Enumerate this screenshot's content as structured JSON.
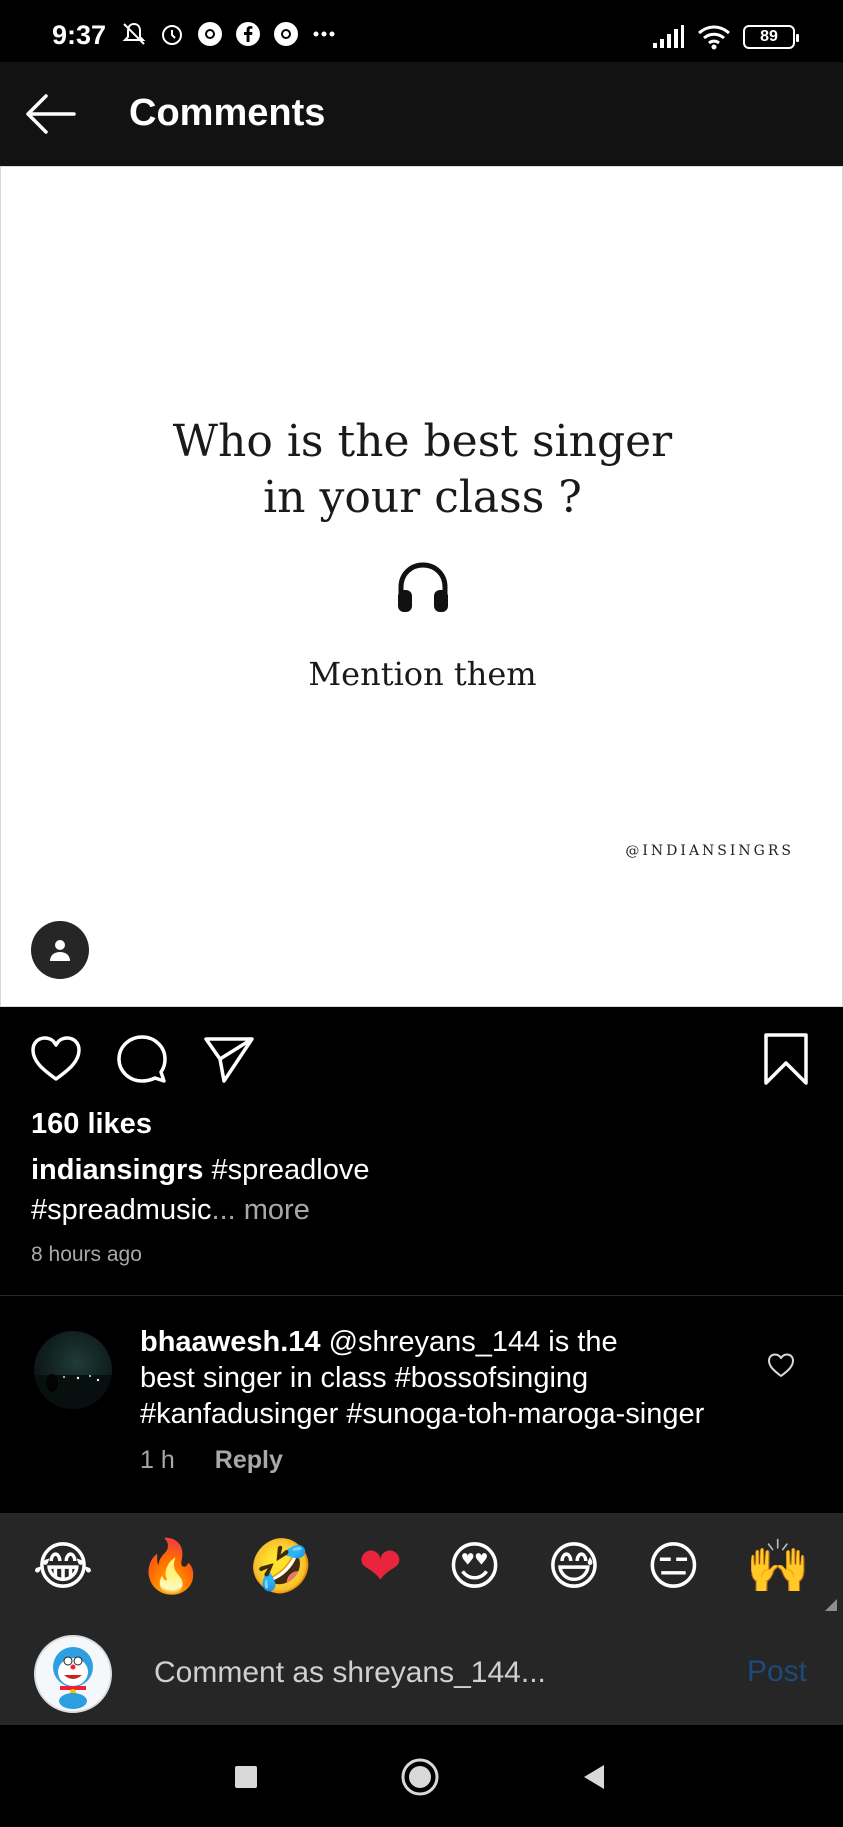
{
  "status_bar": {
    "time": "9:37",
    "battery": "89",
    "left_icons": [
      "mute-bell-icon",
      "alarm-icon",
      "chrome-icon",
      "facebook-icon",
      "chrome-icon",
      "more-dots-icon"
    ],
    "right_icons": [
      "signal-icon",
      "wifi-icon",
      "battery-icon"
    ]
  },
  "app_bar": {
    "title": "Comments",
    "back_icon": "arrow-left-icon"
  },
  "post": {
    "headline_line1": "Who is the best singer",
    "headline_line2": "in your class ?",
    "subtext": "Mention them",
    "watermark": "@INDIANSINGRS",
    "background": "#ffffff",
    "likes": "160 likes",
    "caption_user": "indiansingrs",
    "caption_text_1": " #spreadlove",
    "caption_text_2": "#spreadmusic",
    "caption_more": "... more",
    "time_ago": "8 hours ago"
  },
  "comment": {
    "username": "bhaawesh.14",
    "text_1": " @shreyans_144 is the",
    "text_2": "best singer in class #bossofsinging",
    "text_3": "#kanfadusinger #sunoga-toh-maroga-singer",
    "time": "1 h",
    "reply": "Reply"
  },
  "emoji_bar": [
    "😂",
    "🔥",
    "🤣",
    "❤",
    "😍",
    "😅",
    "😑",
    "🙌"
  ],
  "comment_input": {
    "placeholder": "Comment as shreyans_144...",
    "post_label": "Post"
  },
  "colors": {
    "background": "#000000",
    "app_bar": "#121212",
    "panel": "#262626",
    "muted_text": "#a8a8a8",
    "post_button_disabled": "#1d4a7a"
  }
}
